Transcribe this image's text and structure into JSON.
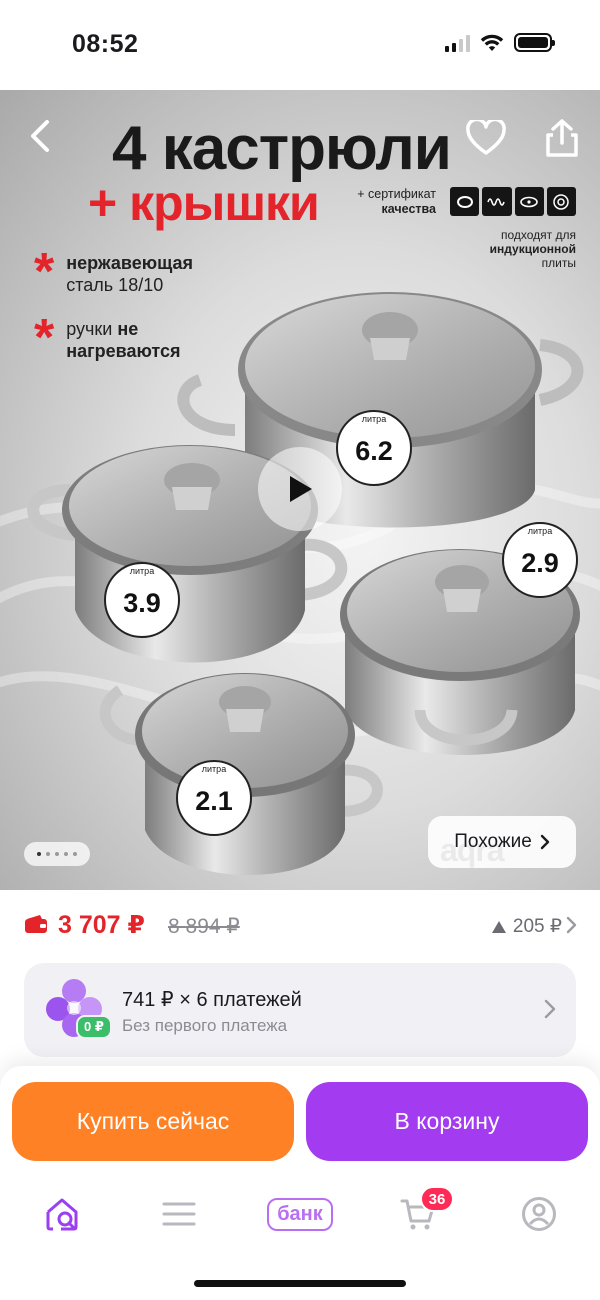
{
  "status_bar": {
    "time": "08:52"
  },
  "hero": {
    "title": "4 кастрюли",
    "subtitle": "+ крышки",
    "certificate_line1": "+ сертификат",
    "certificate_line2": "качества",
    "induction_line1": "подходят для",
    "induction_line2": "индукционной",
    "induction_line3": "плиты",
    "feature1_bold": "нержавеющая",
    "feature1_rest": "сталь 18/10",
    "feature2_a": "ручки",
    "feature2_bold": "не",
    "feature2_b": "нагреваются",
    "pot_unit": "литра",
    "pots": [
      "6.2",
      "3.9",
      "2.9",
      "2.1"
    ],
    "similar_label": "Похожие",
    "brand": "aqra",
    "gallery_count": 5,
    "gallery_active": 1
  },
  "price": {
    "current": "3 707 ₽",
    "old": "8 894 ₽",
    "points": "205 ₽",
    "accent_color": "#e3242b"
  },
  "installment": {
    "badge": "0 ₽",
    "title": "741 ₽ × 6 платежей",
    "subtitle": "Без первого платежа"
  },
  "actions": {
    "buy_now": "Купить сейчас",
    "add_to_cart": "В корзину",
    "buy_color": "#ff8126",
    "cart_color": "#a33bf0"
  },
  "tabbar": {
    "bank_label": "банк",
    "cart_count": "36",
    "icons": [
      "home-search-icon",
      "catalog-menu-icon",
      "bank-icon",
      "cart-icon",
      "profile-icon"
    ]
  }
}
